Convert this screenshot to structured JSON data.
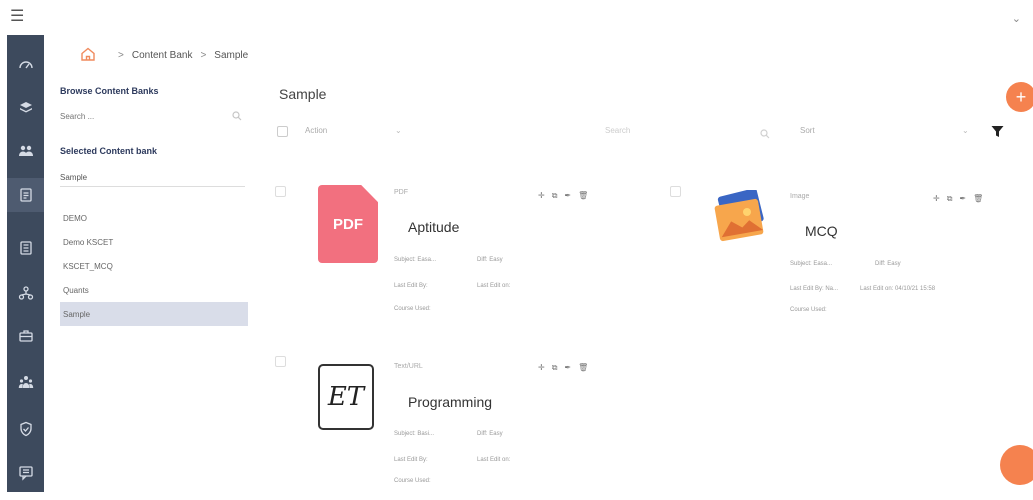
{
  "topbar": {
    "menu_icon": "hamburger-icon",
    "chevron_icon": "chevron-down-icon"
  },
  "rail": {
    "items": [
      {
        "icon": "dashboard-icon"
      },
      {
        "icon": "layers-icon"
      },
      {
        "icon": "users-icon"
      },
      {
        "icon": "document-icon"
      },
      {
        "icon": "report-icon"
      },
      {
        "icon": "network-icon"
      },
      {
        "icon": "briefcase-icon"
      },
      {
        "icon": "people-group-icon"
      },
      {
        "icon": "shield-icon"
      },
      {
        "icon": "message-icon"
      }
    ]
  },
  "breadcrumb": {
    "home_icon": "home-icon",
    "sep": ">",
    "level1": "Content Bank",
    "level2": "Sample"
  },
  "left_panel": {
    "title": "Browse Content Banks",
    "search_placeholder": "Search ...",
    "selected_label": "Selected Content bank",
    "selected_value": "Sample",
    "banks": [
      "DEMO",
      "Demo KSCET",
      "KSCET_MCQ",
      "Quants",
      "Sample"
    ],
    "selected_index": 4
  },
  "main": {
    "title": "Sample",
    "actions_label": "Action",
    "search_placeholder": "Search",
    "sort_label": "Sort",
    "filter_icon": "filter-icon",
    "add_icon": "plus-icon"
  },
  "cards": [
    {
      "type": "PDF",
      "title": "Aptitude",
      "thumb_text": "PDF",
      "subject": "Subject: Easa...",
      "diff": "Diff: Easy",
      "last_edit_by": "Last Edit By:",
      "last_edit_on": "Last Edit on:",
      "course_used": "Course Used:"
    },
    {
      "type": "Image",
      "title": "MCQ",
      "subject": "Subject: Easa...",
      "diff": "Diff: Easy",
      "last_edit_by": "Last Edit By: Na...",
      "last_edit_on": "Last Edit on: 04/10/21 15:58",
      "course_used": "Course Used:"
    },
    {
      "type": "Text/URL",
      "title": "Programming",
      "thumb_text": "ET",
      "subject": "Subject: Basi...",
      "diff": "Diff: Easy",
      "last_edit_by": "Last Edit By:",
      "last_edit_on": "Last Edit on:",
      "course_used": "Course Used:"
    }
  ],
  "colors": {
    "accent": "#f5824f",
    "rail": "#3d4a5d",
    "pdf": "#f2707f"
  }
}
